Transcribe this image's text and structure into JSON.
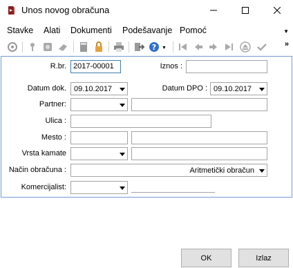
{
  "window": {
    "title": "Unos novog obračuna"
  },
  "menu": {
    "items": [
      "Stavke",
      "Alati",
      "Dokumenti",
      "Podešavanje",
      "Pomoć"
    ]
  },
  "icons": {
    "app": "document-arrow-icon",
    "toolbar": [
      "refresh-icon",
      "key-icon",
      "gear-icon",
      "eraser-icon",
      "calculator-icon",
      "lock-icon",
      "print-icon",
      "export-icon",
      "help-icon",
      "first-record-icon",
      "prev-record-icon",
      "next-record-icon",
      "last-record-icon",
      "eject-icon",
      "check-icon"
    ]
  },
  "form": {
    "rbr": {
      "label": "R.br.",
      "value": "2017-00001"
    },
    "iznos": {
      "label": "Iznos :",
      "value": ""
    },
    "datum_dok": {
      "label": "Datum dok.",
      "value": "09.10.2017"
    },
    "datum_dpo": {
      "label": "Datum DPO :",
      "value": "09.10.2017"
    },
    "partner": {
      "label": "Partner:",
      "value": "",
      "name": ""
    },
    "ulica": {
      "label": "Ulica :",
      "value": ""
    },
    "mesto": {
      "label": "Mesto :",
      "code": "",
      "name": ""
    },
    "vrsta_kamate": {
      "label": "Vrsta kamate",
      "value": "",
      "name": ""
    },
    "nacin_obracuna": {
      "label": "Način obračuna :",
      "value": "Aritmetički obračun"
    },
    "komercijalist": {
      "label": "Komercijalist:",
      "value": "",
      "name": ""
    }
  },
  "buttons": {
    "ok": "OK",
    "izlaz": "Izlaz"
  },
  "colors": {
    "panel_border": "#6f9bd1",
    "focus_border": "#3c7fb1",
    "button_bg": "#e1e1e1"
  }
}
